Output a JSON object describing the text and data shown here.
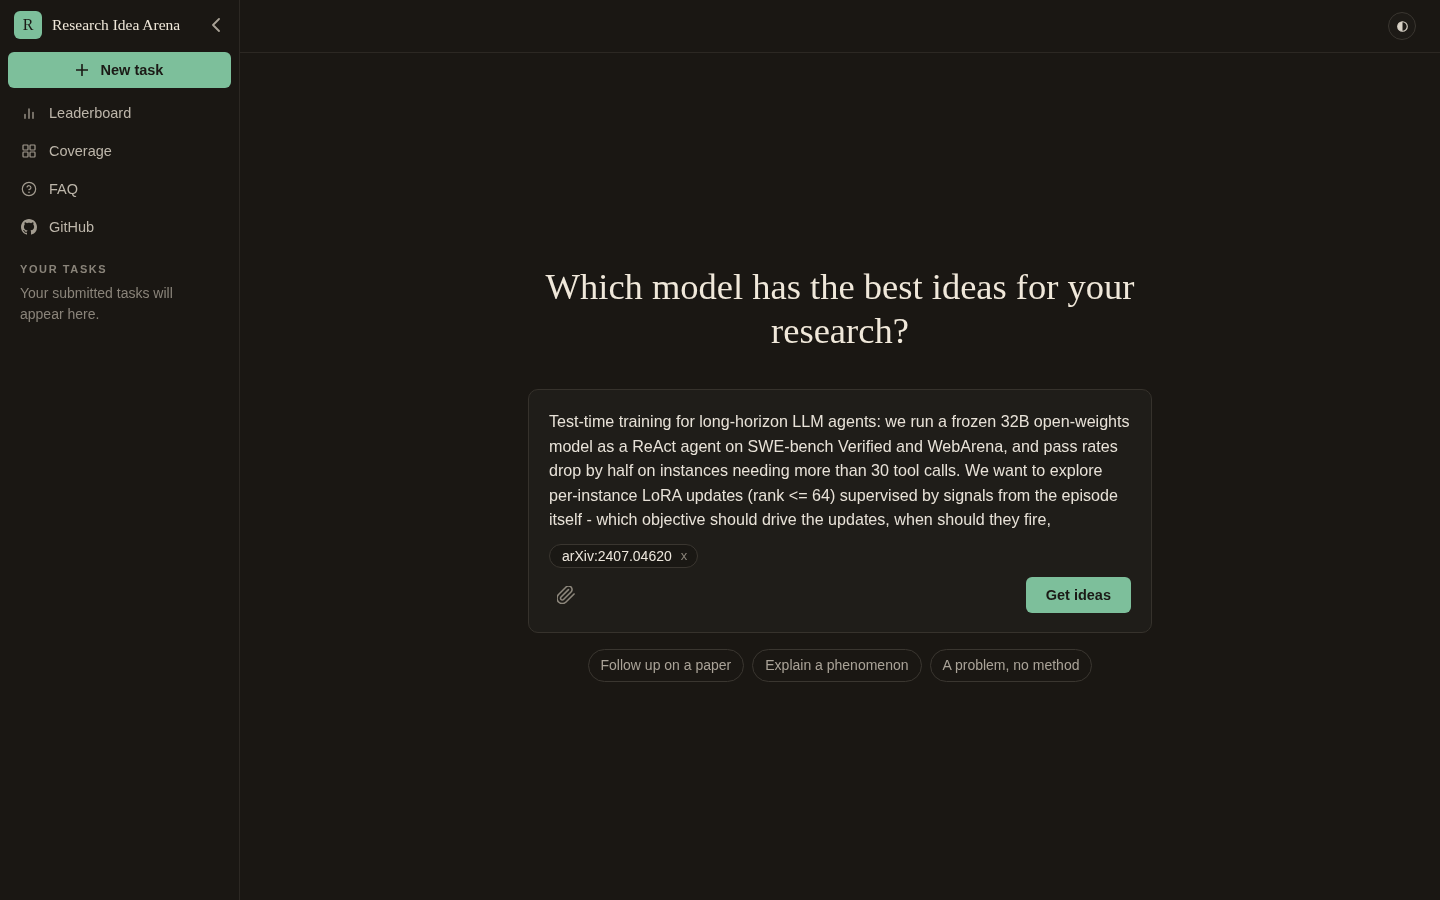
{
  "sidebar": {
    "logo": "R",
    "title": "Research Idea Arena",
    "new_task_button": "New task",
    "nav_items": [
      {
        "label": "Leaderboard"
      },
      {
        "label": "Coverage"
      },
      {
        "label": "FAQ"
      },
      {
        "label": "GitHub"
      }
    ],
    "your_tasks": {
      "heading": "YOUR TASKS",
      "empty_message": "Your submitted tasks will appear here."
    }
  },
  "main": {
    "heading": "Which model has the best ideas for your research?",
    "task_input": {
      "value": "Test-time training for long-horizon LLM agents: we run a frozen 32B open-weights model as a ReAct agent on SWE-bench Verified and WebArena, and pass rates drop by half on instances needing more than 30 tool calls. We want to explore per-instance LoRA updates (rank <= 64) supervised by signals from the episode itself - which objective should drive the updates, when should they fire,"
    },
    "attachments": [
      {
        "label": "arXiv:2407.04620",
        "remove": "x"
      }
    ],
    "submit_button": "Get ideas",
    "suggestions": [
      "Follow up on a paper",
      "Explain a phenomenon",
      "A problem, no method"
    ]
  }
}
